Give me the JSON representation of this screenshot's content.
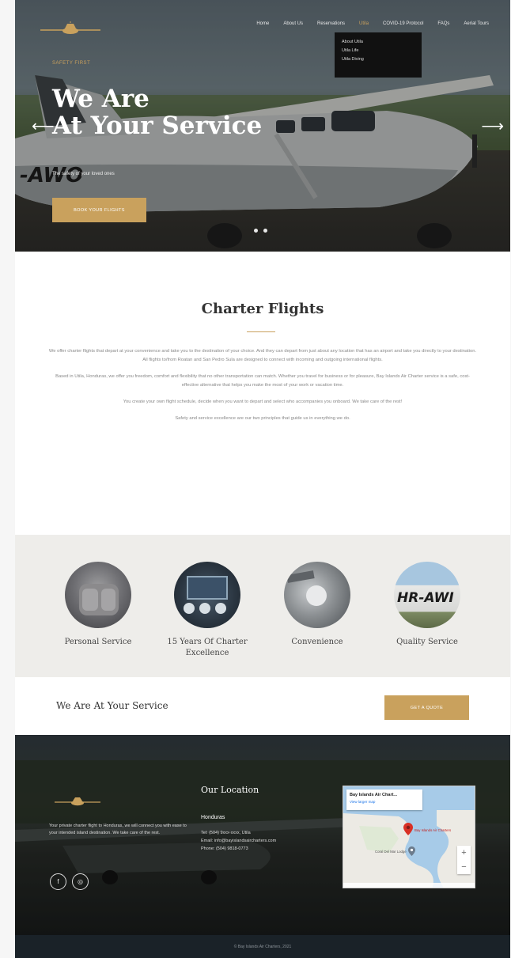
{
  "colors": {
    "accent": "#c9a15d",
    "dark_bar": "#1a2228",
    "feature_bg": "#eeedea"
  },
  "header": {
    "logo_icon": "airplane-logo-icon",
    "nav": [
      "Home",
      "About Us",
      "Reservations",
      "Utila",
      "COVID-19 Protocol",
      "FAQs",
      "Aerial Tours"
    ],
    "active_index": 3,
    "dropdown": [
      "About Utila",
      "Utila Life",
      "Utila Diving"
    ]
  },
  "hero": {
    "kicker": "SAFETY FIRST",
    "title_line1": "We Are",
    "title_line2": "At Your Service",
    "subtitle": "The safety of your loved ones",
    "button": "BOOK YOUR FLIGHTS",
    "prev_icon": "arrow-left-icon",
    "next_icon": "arrow-right-icon"
  },
  "charter": {
    "title": "Charter Flights",
    "paragraphs": [
      "We offer charter flights that depart at your convenience and take you to the destination of your choice. And they can depart from just about any location that has an airport and take you directly to your destination. All flights to/from Roatan and San Pedro Sula are designed to connect with incoming and outgoing international flights.",
      "Based in Utila, Honduras, we offer you freedom, comfort and flexibility that no other transportation can match. Whether you travel for business or for pleasure, Bay Islands Air Charter service is a safe, cost-effective alternative that helps you make the most of your work or vacation time.",
      "You create your own flight schedule, decide when you want to depart and select who accompanies you onboard. We take care of the rest!",
      "Safety and service excellence are our two principles that guide us in everything we do."
    ]
  },
  "features": [
    {
      "label": "Personal Service"
    },
    {
      "label": "15 Years Of Charter Excellence"
    },
    {
      "label": "Convenience"
    },
    {
      "label": "Quality Service"
    }
  ],
  "cta": {
    "text": "We Are At Your Service",
    "button": "GET A QUOTE"
  },
  "footer": {
    "about": "Your private charter flight to Honduras, we will connect you with ease to your intended island destination. We take care of the rest.",
    "social": [
      {
        "icon": "facebook-icon",
        "glyph": "f"
      },
      {
        "icon": "instagram-icon",
        "glyph": "◎"
      }
    ],
    "location_title": "Our Location",
    "location_subtitle": "Honduras",
    "location_lines": [
      "Tel: (504) 9xxx-xxxx, Utila",
      "Email: info@bayislandsaircharters.com",
      "Phone: (504) 9818-0773"
    ],
    "map": {
      "card_title": "Bay Islands Air Chart...",
      "card_link": "View larger map",
      "pin_label": "Bay Islands Air Charters",
      "place_label": "Coral Del Mar Lodge",
      "zoom_in": "+",
      "zoom_out": "−"
    },
    "copyright": "© Bay Islands Air Charters, 2021"
  }
}
